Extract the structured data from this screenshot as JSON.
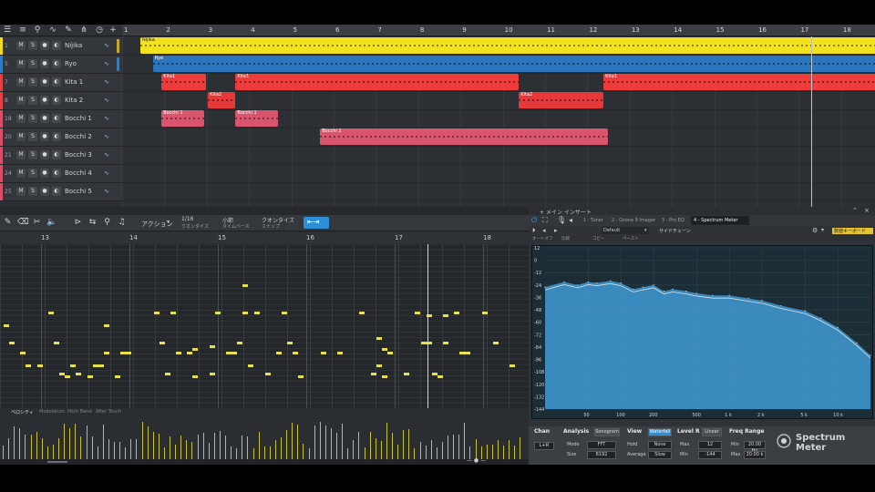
{
  "arrange": {
    "ruler_marks": [
      "1",
      "2",
      "3",
      "4",
      "5",
      "6",
      "7",
      "8",
      "9",
      "10",
      "11",
      "12",
      "13",
      "14",
      "15",
      "16",
      "17",
      "18"
    ],
    "tracks": [
      {
        "num": "1",
        "name": "Nijika",
        "color": "#f0dc1e"
      },
      {
        "num": "5",
        "name": "Ryo",
        "color": "#2f7ac0"
      },
      {
        "num": "7",
        "name": "Kita 1",
        "color": "#e84040"
      },
      {
        "num": "8",
        "name": "Kita 2",
        "color": "#e84040"
      },
      {
        "num": "18",
        "name": "Bocchi 1",
        "color": "#d94c6a"
      },
      {
        "num": "20",
        "name": "Bocchi 2",
        "color": "#d94c6a"
      },
      {
        "num": "21",
        "name": "Bocchi 3",
        "color": "#d94c6a"
      },
      {
        "num": "24",
        "name": "Bocchi 4",
        "color": "#d94c6a"
      },
      {
        "num": "25",
        "name": "Bocchi 5",
        "color": "#d94c6a"
      }
    ],
    "track_buttons": [
      "M",
      "S",
      "●",
      "◐"
    ],
    "clips": [
      {
        "lane": 0,
        "name": "Nijika",
        "start": 1.0,
        "end": 18.4,
        "color": "#f2e21d"
      },
      {
        "lane": 1,
        "name": "Rye",
        "start": 1.3,
        "end": 18.4,
        "color": "#2c74bc"
      },
      {
        "lane": 2,
        "name": "Kita1",
        "start": 1.5,
        "end": 2.55,
        "color": "#ee3b3b"
      },
      {
        "lane": 2,
        "name": "Kita1",
        "start": 3.25,
        "end": 9.95,
        "color": "#ee3b3b"
      },
      {
        "lane": 2,
        "name": "Kita1",
        "start": 11.95,
        "end": 18.4,
        "color": "#ee3b3b"
      },
      {
        "lane": 3,
        "name": "Kita2",
        "start": 2.6,
        "end": 3.25,
        "color": "#e63838"
      },
      {
        "lane": 3,
        "name": "Kita2",
        "start": 9.95,
        "end": 11.95,
        "color": "#e63838"
      },
      {
        "lane": 4,
        "name": "Bocchi 1",
        "start": 1.5,
        "end": 2.5,
        "color": "#d9546d"
      },
      {
        "lane": 4,
        "name": "Bocchi 1",
        "start": 3.25,
        "end": 4.25,
        "color": "#d9546d"
      },
      {
        "lane": 5,
        "name": "Bocchi 2",
        "start": 5.25,
        "end": 12.05,
        "color": "#d9546d"
      }
    ]
  },
  "editor": {
    "quantize": {
      "value": "1/16",
      "label": "クオンタイズ"
    },
    "timebase": {
      "value": "小節",
      "label": "タイムベース"
    },
    "snap": {
      "value": "クオンタイズ",
      "label": "スナップ"
    },
    "action_label": "アクション",
    "ruler_marks": [
      "13",
      "14",
      "15",
      "16",
      "17",
      "18"
    ],
    "tabs": [
      "ベロシティ",
      "Modulation",
      "Pitch Bend",
      "After Touch"
    ]
  },
  "inspector": {
    "strip_text": "+ メイン インサート"
  },
  "spectrum": {
    "inserts": [
      "1 - Tuner",
      "2 - Ozone 9 Imager",
      "3 - Pro EQ",
      "4 - Spectrum Meter"
    ],
    "preset": "Default",
    "sidechain": "サイドチェーン",
    "sub_buttons": [
      "オートオフ",
      "比較",
      "コピー",
      "ペースト"
    ],
    "helper_button": "数値キーボード",
    "db_ticks": [
      "12",
      "0",
      "-12",
      "-24",
      "-36",
      "-48",
      "-60",
      "-72",
      "-84",
      "-96",
      "-108",
      "-120",
      "-132",
      "-144"
    ],
    "freq_ticks": [
      "50",
      "100",
      "200",
      "500",
      "1 k",
      "2 k",
      "5 k",
      "10 k"
    ],
    "chan": {
      "title": "Chan",
      "value": "L+R"
    },
    "analysis": {
      "title": "Analysis",
      "toggle": "Sonogram",
      "mode_label": "Mode",
      "mode_value": "FFT",
      "size_label": "Size",
      "size_value": "8192"
    },
    "view": {
      "title": "View",
      "toggle": "Waterfall",
      "hold_label": "Hold",
      "hold_value": "None",
      "average_label": "Average",
      "average_value": "Slow"
    },
    "level": {
      "title": "Level R",
      "toggle": "Linear",
      "max_label": "Max",
      "max_value": "12",
      "min_label": "Min",
      "min_value": "-144"
    },
    "freq": {
      "title": "Freq Range",
      "min_label": "Min",
      "min_value": "20.00 Hz",
      "max_label": "Max",
      "max_value": "20.00 k"
    },
    "logo_line1": "Spectrum",
    "logo_line2": "Meter"
  },
  "chart_data": {
    "type": "area",
    "title": "",
    "xlabel": "",
    "ylabel": "",
    "x_scale": "log",
    "xlim": [
      20,
      20000
    ],
    "ylim": [
      -144,
      12
    ],
    "x": [
      20,
      30,
      40,
      50,
      60,
      80,
      100,
      130,
      160,
      200,
      250,
      300,
      400,
      500,
      700,
      1000,
      1500,
      2000,
      3000,
      5000,
      7000,
      10000,
      15000,
      20000
    ],
    "values": [
      -26,
      -21,
      -24,
      -21,
      -22,
      -20,
      -22,
      -28,
      -26,
      -24,
      -30,
      -28,
      -30,
      -32,
      -34,
      -34,
      -37,
      -39,
      -44,
      -49,
      -56,
      -65,
      -80,
      -92
    ],
    "colors": {
      "fill": "#3d8fc6",
      "line": "#e0e0e0"
    }
  }
}
